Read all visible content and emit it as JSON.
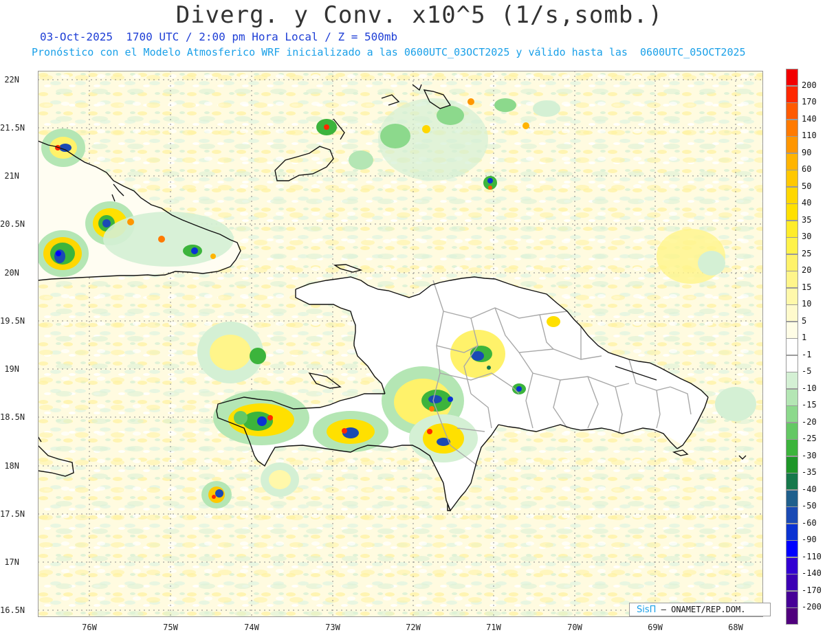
{
  "header": {
    "title": "Diverg. y Conv. x10^5 (1/s,somb.)",
    "subtitle_line1": "03-Oct-2025  1700 UTC / 2:00 pm Hora Local / Z = 500mb",
    "subtitle_line2": "Pronóstico con el Modelo Atmosferico WRF inicializado a las 0600UTC_03OCT2025 y válido hasta las  0600UTC_05OCT2025"
  },
  "axes": {
    "lat_labels": [
      "22N",
      "21.5N",
      "21N",
      "20.5N",
      "20N",
      "19.5N",
      "19N",
      "18.5N",
      "18N",
      "17.5N",
      "17N",
      "16.5N"
    ],
    "lon_labels": [
      "76W",
      "75W",
      "74W",
      "73W",
      "72W",
      "71W",
      "70W",
      "69W",
      "68W"
    ]
  },
  "legend": {
    "labels": [
      "200",
      "170",
      "140",
      "110",
      "90",
      "60",
      "50",
      "40",
      "35",
      "30",
      "25",
      "20",
      "15",
      "10",
      "5",
      "1",
      "-1",
      "-5",
      "-10",
      "-15",
      "-20",
      "-25",
      "-30",
      "-35",
      "-40",
      "-50",
      "-60",
      "-90",
      "-110",
      "-140",
      "-170",
      "-200"
    ],
    "colors": [
      "#f20000",
      "#ff2800",
      "#ff5a00",
      "#ff7a00",
      "#ff9600",
      "#ffb400",
      "#ffc800",
      "#ffd700",
      "#ffe000",
      "#ffec2a",
      "#fff24a",
      "#fff26a",
      "#fff58a",
      "#fff8aa",
      "#fffacc",
      "#fffde6",
      "#ffffff",
      "#ffffff",
      "#d4f0d4",
      "#b4e6b4",
      "#8cd98c",
      "#64c864",
      "#3cb43c",
      "#1e9628",
      "#16784b",
      "#1f5f8c",
      "#1a4ab4",
      "#0a32d2",
      "#0000ff",
      "#3200d2",
      "#3c00b4",
      "#460096",
      "#50007d"
    ]
  },
  "credit": {
    "brand": "SisΠ",
    "text": " – ONAMET/REP.DOM."
  }
}
